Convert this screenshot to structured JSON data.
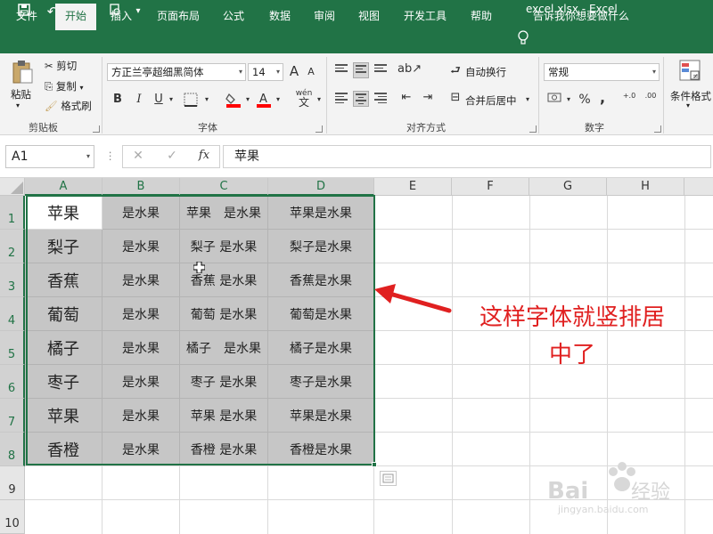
{
  "titlebar": {
    "title": "excel.xlsx - Excel"
  },
  "tabs": [
    "文件",
    "开始",
    "插入",
    "页面布局",
    "公式",
    "数据",
    "审阅",
    "视图",
    "开发工具",
    "帮助"
  ],
  "tell_me": "告诉我你想要做什么",
  "ribbon": {
    "clipboard": {
      "paste": "粘贴",
      "cut": "剪切",
      "copy": "复制",
      "format_painter": "格式刷",
      "label": "剪贴板"
    },
    "font": {
      "name": "方正兰亭超细黑简体",
      "size": "14",
      "grow": "A",
      "shrink": "A",
      "bold": "B",
      "italic": "I",
      "underline": "U",
      "phonetic": "wén",
      "label": "字体"
    },
    "alignment": {
      "wrap": "自动换行",
      "merge": "合并后居中",
      "label": "对齐方式"
    },
    "number": {
      "format": "常规",
      "percent": "%",
      "comma": ",",
      "inc": "+.0",
      "dec": ".00",
      "label": "数字"
    },
    "styles": {
      "conditional": "条件格式"
    }
  },
  "formula_bar": {
    "name_box": "A1",
    "fx": "fx",
    "content": "苹果"
  },
  "columns": [
    "A",
    "B",
    "C",
    "D",
    "E",
    "F",
    "G",
    "H"
  ],
  "rows": [
    "1",
    "2",
    "3",
    "4",
    "5",
    "6",
    "7",
    "8",
    "9",
    "10"
  ],
  "cells": [
    [
      "苹果",
      "是水果",
      "苹果　是水果",
      "苹果是水果"
    ],
    [
      "梨子",
      "是水果",
      "梨子 是水果",
      "梨子是水果"
    ],
    [
      "香蕉",
      "是水果",
      "香蕉 是水果",
      "香蕉是水果"
    ],
    [
      "葡萄",
      "是水果",
      "葡萄 是水果",
      "葡萄是水果"
    ],
    [
      "橘子",
      "是水果",
      "橘子　是水果",
      "橘子是水果"
    ],
    [
      "枣子",
      "是水果",
      "枣子 是水果",
      "枣子是水果"
    ],
    [
      "苹果",
      "是水果",
      "苹果 是水果",
      "苹果是水果"
    ],
    [
      "香橙",
      "是水果",
      "香橙 是水果",
      "香橙是水果"
    ]
  ],
  "annotation": {
    "line1": "这样字体就竖排居",
    "line2": "中了",
    "color": "#e02020"
  },
  "colors": {
    "accent": "#217346",
    "selection": "#c6c6c6"
  }
}
